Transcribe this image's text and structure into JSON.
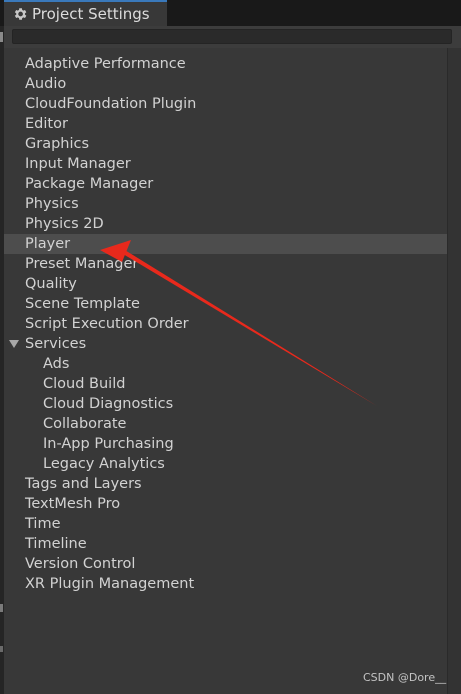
{
  "window": {
    "tab_title": "Project Settings",
    "tab_icon": "gear-icon"
  },
  "search": {
    "value": ""
  },
  "settings_list": [
    {
      "label": "Adaptive Performance",
      "level": 0
    },
    {
      "label": "Audio",
      "level": 0
    },
    {
      "label": "CloudFoundation Plugin",
      "level": 0
    },
    {
      "label": "Editor",
      "level": 0
    },
    {
      "label": "Graphics",
      "level": 0
    },
    {
      "label": "Input Manager",
      "level": 0
    },
    {
      "label": "Package Manager",
      "level": 0
    },
    {
      "label": "Physics",
      "level": 0
    },
    {
      "label": "Physics 2D",
      "level": 0
    },
    {
      "label": "Player",
      "level": 0,
      "selected": true
    },
    {
      "label": "Preset Manager",
      "level": 0
    },
    {
      "label": "Quality",
      "level": 0
    },
    {
      "label": "Scene Template",
      "level": 0
    },
    {
      "label": "Script Execution Order",
      "level": 0
    },
    {
      "label": "Services",
      "level": 0,
      "expanded": true
    },
    {
      "label": "Ads",
      "level": 1
    },
    {
      "label": "Cloud Build",
      "level": 1
    },
    {
      "label": "Cloud Diagnostics",
      "level": 1
    },
    {
      "label": "Collaborate",
      "level": 1
    },
    {
      "label": "In-App Purchasing",
      "level": 1
    },
    {
      "label": "Legacy Analytics",
      "level": 1
    },
    {
      "label": "Tags and Layers",
      "level": 0
    },
    {
      "label": "TextMesh Pro",
      "level": 0
    },
    {
      "label": "Time",
      "level": 0
    },
    {
      "label": "Timeline",
      "level": 0
    },
    {
      "label": "Version Control",
      "level": 0
    },
    {
      "label": "XR Plugin Management",
      "level": 0
    }
  ],
  "annotation": {
    "arrow_color": "#e8291c",
    "points_to": "Player"
  },
  "watermark": "CSDN @Dore__",
  "colors": {
    "background": "#383838",
    "selected_row": "#4d4d4d",
    "text": "#d2d2d2",
    "tab_accent": "#3a79bb"
  }
}
